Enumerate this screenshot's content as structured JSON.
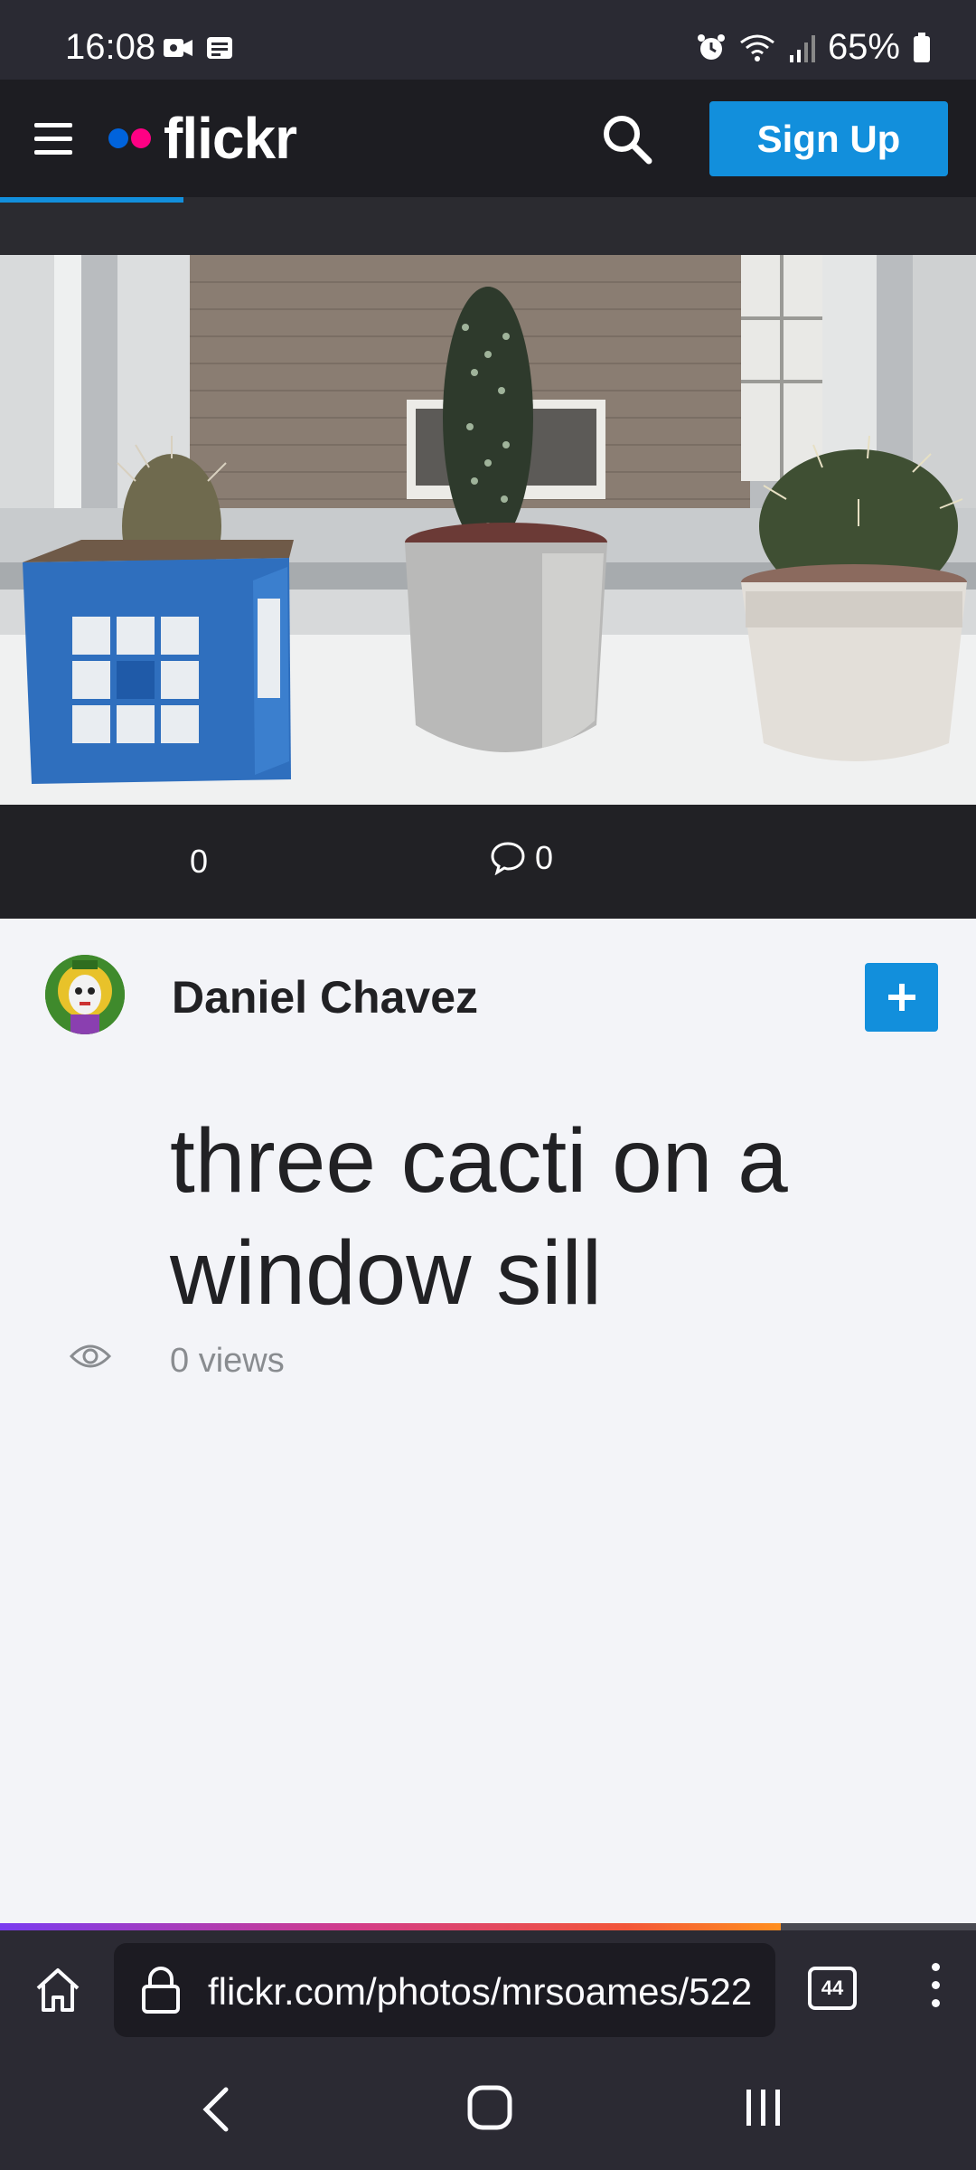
{
  "status_bar": {
    "time": "16:08",
    "battery": "65%"
  },
  "header": {
    "logo_text": "flickr",
    "signup_label": "Sign Up",
    "colors": {
      "brand_blue": "#0063dc",
      "brand_pink": "#ff0084",
      "button_blue": "#128fdc"
    }
  },
  "photo": {
    "subject": "three cacti on a window sill",
    "fav_count": "0",
    "comment_count": "0"
  },
  "owner": {
    "name": "Daniel Chavez",
    "follow_label": "+"
  },
  "content": {
    "title": "three cacti on a window sill",
    "views": "0 views"
  },
  "browser": {
    "url": "flickr.com/photos/mrsoames/522",
    "tab_count": "44",
    "load_progress": 0.8
  }
}
